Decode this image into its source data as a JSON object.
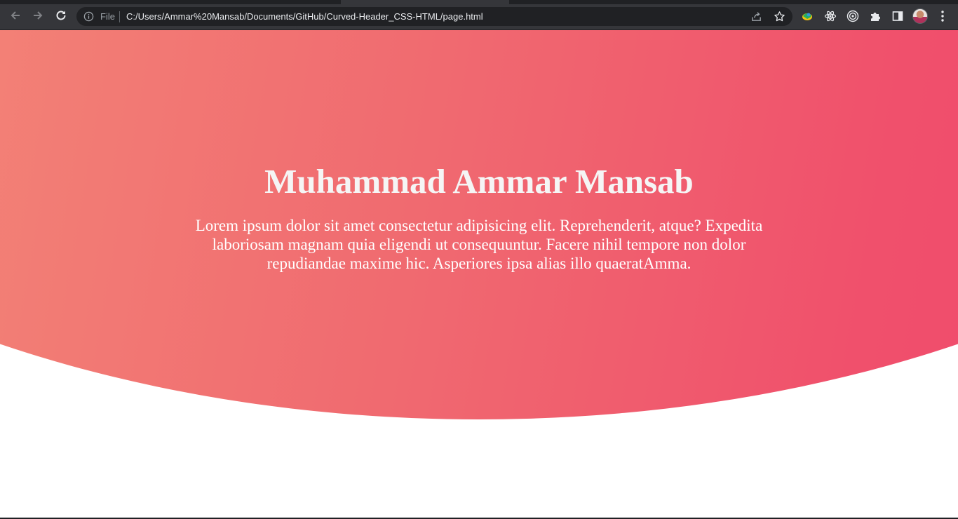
{
  "browser": {
    "nav": {
      "back_icon": "arrow-left-icon",
      "forward_icon": "arrow-right-icon",
      "reload_icon": "reload-icon"
    },
    "omnibox": {
      "scheme_label": "File",
      "url": "C:/Users/Ammar%20Mansab/Documents/GitHub/Curved-Header_CSS-HTML/page.html",
      "info_icon": "info-icon",
      "share_icon": "share-icon",
      "bookmark_icon": "star-icon"
    },
    "extensions": [
      "globe-extension-icon",
      "react-devtools-icon",
      "target-extension-icon",
      "puzzle-icon",
      "side-panel-icon"
    ],
    "profile_icon": "avatar",
    "menu_icon": "kebab-menu-icon"
  },
  "header": {
    "title": "Muhammad Ammar Mansab",
    "text": "Lorem ipsum dolor sit amet consectetur adipisicing elit. Reprehenderit, atque? Expedita laboriosam magnam quia eligendi ut consequuntur. Facere nihil tempore non dolor repudiandae maxime hic. Asperiores ipsa alias illo quaeratAmma."
  },
  "colors": {
    "gradient_start": "#f3987c",
    "gradient_end": "#f03f6a",
    "chrome_bg": "#35363a",
    "omnibox_bg": "#202124"
  }
}
